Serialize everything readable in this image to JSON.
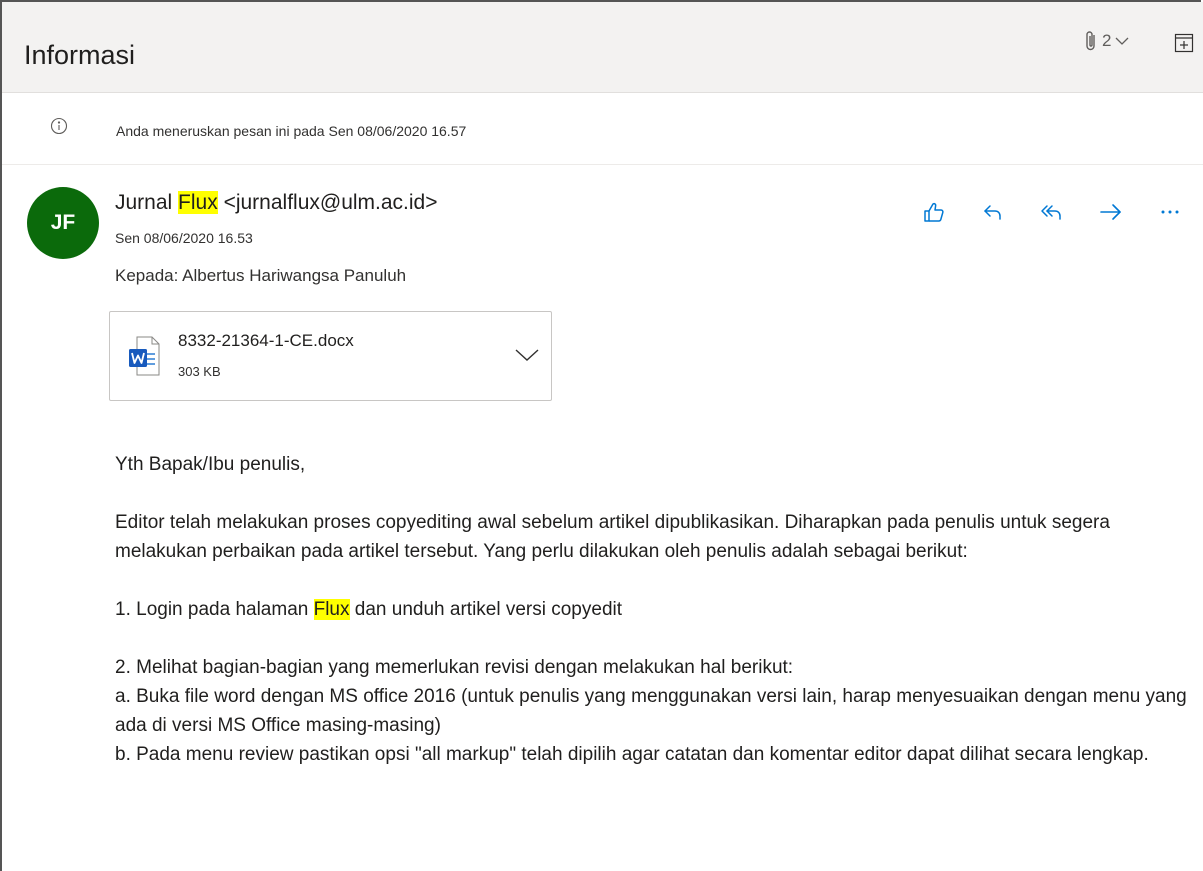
{
  "header": {
    "subject": "Informasi",
    "attachment_count": "2",
    "attachment_icon": "paperclip-icon",
    "expand_icon": "pop-out-icon"
  },
  "info": {
    "text": "Anda meneruskan pesan ini pada Sen 08/06/2020 16.57",
    "icon": "info-icon"
  },
  "message": {
    "avatar_initials": "JF",
    "avatar_color": "#0b6a0b",
    "sender_name_before": "Jurnal",
    "sender_name_highlight": "Flux",
    "sender_email": "<jurnalflux@ulm.ac.id>",
    "date": "Sen 08/06/2020 16.53",
    "to_label": "Kepada:",
    "to_name": "Albertus Hariwangsa Panuluh",
    "actions": [
      "like-icon",
      "reply-icon",
      "reply-all-icon",
      "forward-icon",
      "more-icon"
    ]
  },
  "attachment": {
    "file_name": "8332-21364-1-CE.docx",
    "file_size": "303 KB",
    "icon": "word-file-icon"
  },
  "body": {
    "greeting": "Yth Bapak/Ibu penulis,",
    "para1": "Editor telah melakukan proses copyediting awal sebelum artikel dipublikasikan. Diharapkan pada penulis untuk segera melakukan perbaikan pada artikel tersebut. Yang perlu dilakukan oleh penulis adalah sebagai berikut:",
    "step1_before": "1. Login pada halaman",
    "step1_highlight": "Flux",
    "step1_after": "dan unduh artikel versi copyedit",
    "step2": "2. Melihat bagian-bagian yang memerlukan revisi dengan melakukan hal berikut:",
    "step2a": "a. Buka file word dengan MS office 2016 (untuk penulis yang menggunakan versi lain, harap menyesuaikan dengan menu yang ada di versi MS Office masing-masing)",
    "step2b": "b. Pada menu review pastikan opsi \"all markup\" telah dipilih agar catatan dan komentar editor dapat dilihat secara lengkap."
  },
  "colors": {
    "accent": "#0078d4",
    "highlight": "#ffff00",
    "header_bg": "#f3f2f1"
  }
}
